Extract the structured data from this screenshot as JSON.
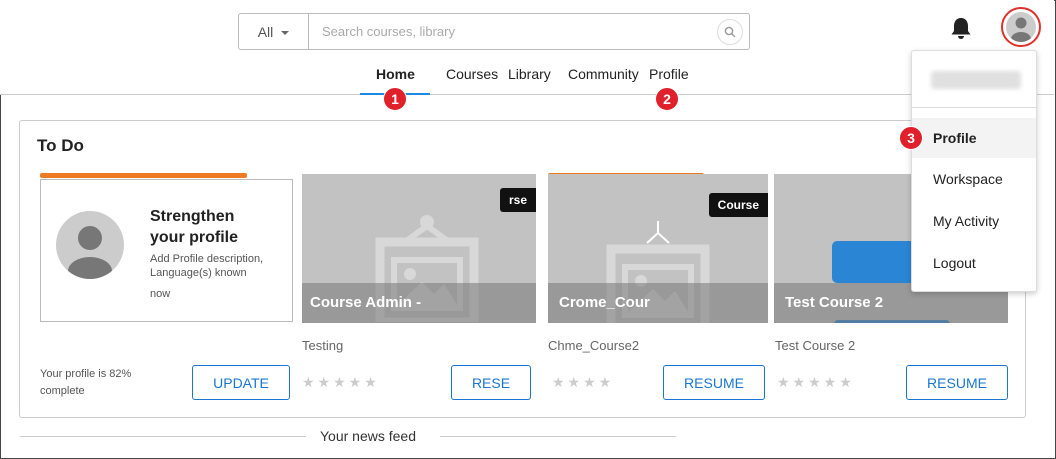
{
  "header": {
    "search": {
      "scope_label": "All",
      "placeholder": "Search courses, library"
    },
    "nav": [
      {
        "label": "Home",
        "active": true
      },
      {
        "label": "Courses"
      },
      {
        "label": "Library"
      },
      {
        "label": "Community"
      },
      {
        "label": "Profile"
      }
    ],
    "badges": [
      "1",
      "2",
      "3"
    ]
  },
  "todo": {
    "title": "To Do",
    "profile_card": {
      "title": "Strengthen your profile",
      "lines": [
        "Add Profile description,",
        "Language(s) known",
        "now"
      ],
      "progress_text": "Your profile is 82% complete",
      "progress_fraction": 0.82,
      "button": "UPDATE"
    },
    "courses": [
      {
        "tag": "rse",
        "title": "Course Admin -",
        "subtitle": "Testing",
        "button": "RESE",
        "progress_fraction": 0
      },
      {
        "tag": "Course",
        "title": "Crome_Cour",
        "subtitle": "Chme_Course2",
        "button": "RESUME",
        "progress_fraction": 0.7
      },
      {
        "tag": "",
        "title": "Test Course 2",
        "subtitle": "Test Course 2",
        "button": "RESUME",
        "progress_fraction": 0
      }
    ]
  },
  "feed": {
    "label": "Your news feed"
  },
  "user_menu": {
    "items": [
      {
        "label": "Profile",
        "active": true
      },
      {
        "label": "Workspace"
      },
      {
        "label": "My Activity"
      },
      {
        "label": "Logout"
      }
    ]
  },
  "colors": {
    "accent": "#1976d2",
    "progress": "#ee7a24",
    "badge": "#e0212b",
    "avatar_ring": "#e0312b"
  }
}
